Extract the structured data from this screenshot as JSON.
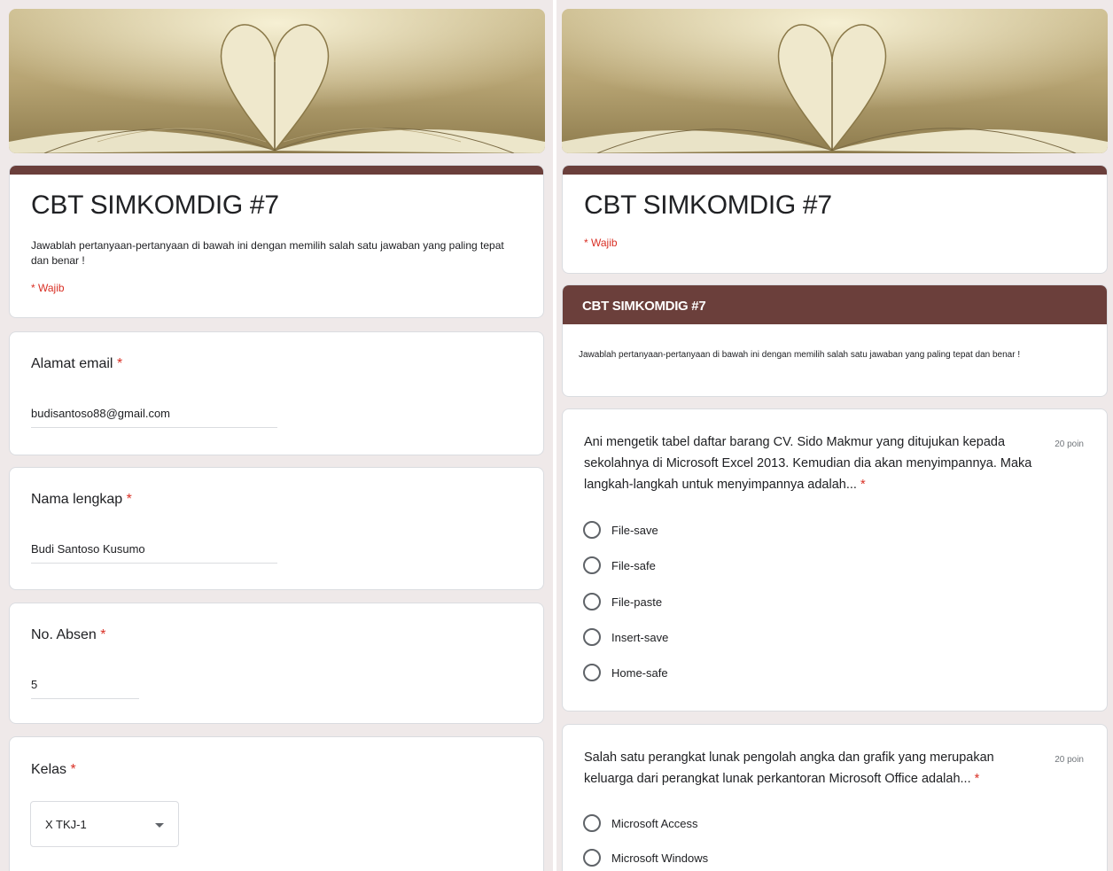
{
  "left": {
    "form_title": "CBT SIMKOMDIG #7",
    "form_description": "Jawablah pertanyaan-pertanyaan di bawah ini dengan memilih salah satu jawaban yang paling tepat dan benar !",
    "required_note": "* Wajib",
    "fields": [
      {
        "label": "Alamat email",
        "value": "budisantoso88@gmail.com"
      },
      {
        "label": "Nama lengkap",
        "value": "Budi Santoso Kusumo"
      },
      {
        "label": "No. Absen",
        "value": "5"
      },
      {
        "label": "Kelas",
        "value": "X TKJ-1"
      }
    ]
  },
  "right": {
    "form_title": "CBT SIMKOMDIG #7",
    "required_note": "* Wajib",
    "section_title": "CBT SIMKOMDIG #7",
    "section_description": "Jawablah pertanyaan-pertanyaan di bawah ini dengan memilih salah satu jawaban yang paling tepat dan benar !",
    "questions": [
      {
        "text": "Ani mengetik tabel daftar barang CV. Sido Makmur yang ditujukan kepada sekolahnya di Microsoft Excel 2013. Kemudian dia akan menyimpannya. Maka langkah-langkah untuk menyimpannya adalah...",
        "points": "20 poin",
        "options": [
          "File-save",
          "File-safe",
          "File-paste",
          "Insert-save",
          "Home-safe"
        ]
      },
      {
        "text": "Salah satu perangkat lunak pengolah angka dan grafik yang merupakan keluarga dari perangkat lunak perkantoran Microsoft Office adalah...",
        "points": "20 poin",
        "options": [
          "Microsoft Access",
          "Microsoft Windows"
        ]
      }
    ]
  },
  "required_star": "*",
  "colors": {
    "theme": "#6b3f3b",
    "background": "#efe9e9",
    "required": "#d93025"
  }
}
